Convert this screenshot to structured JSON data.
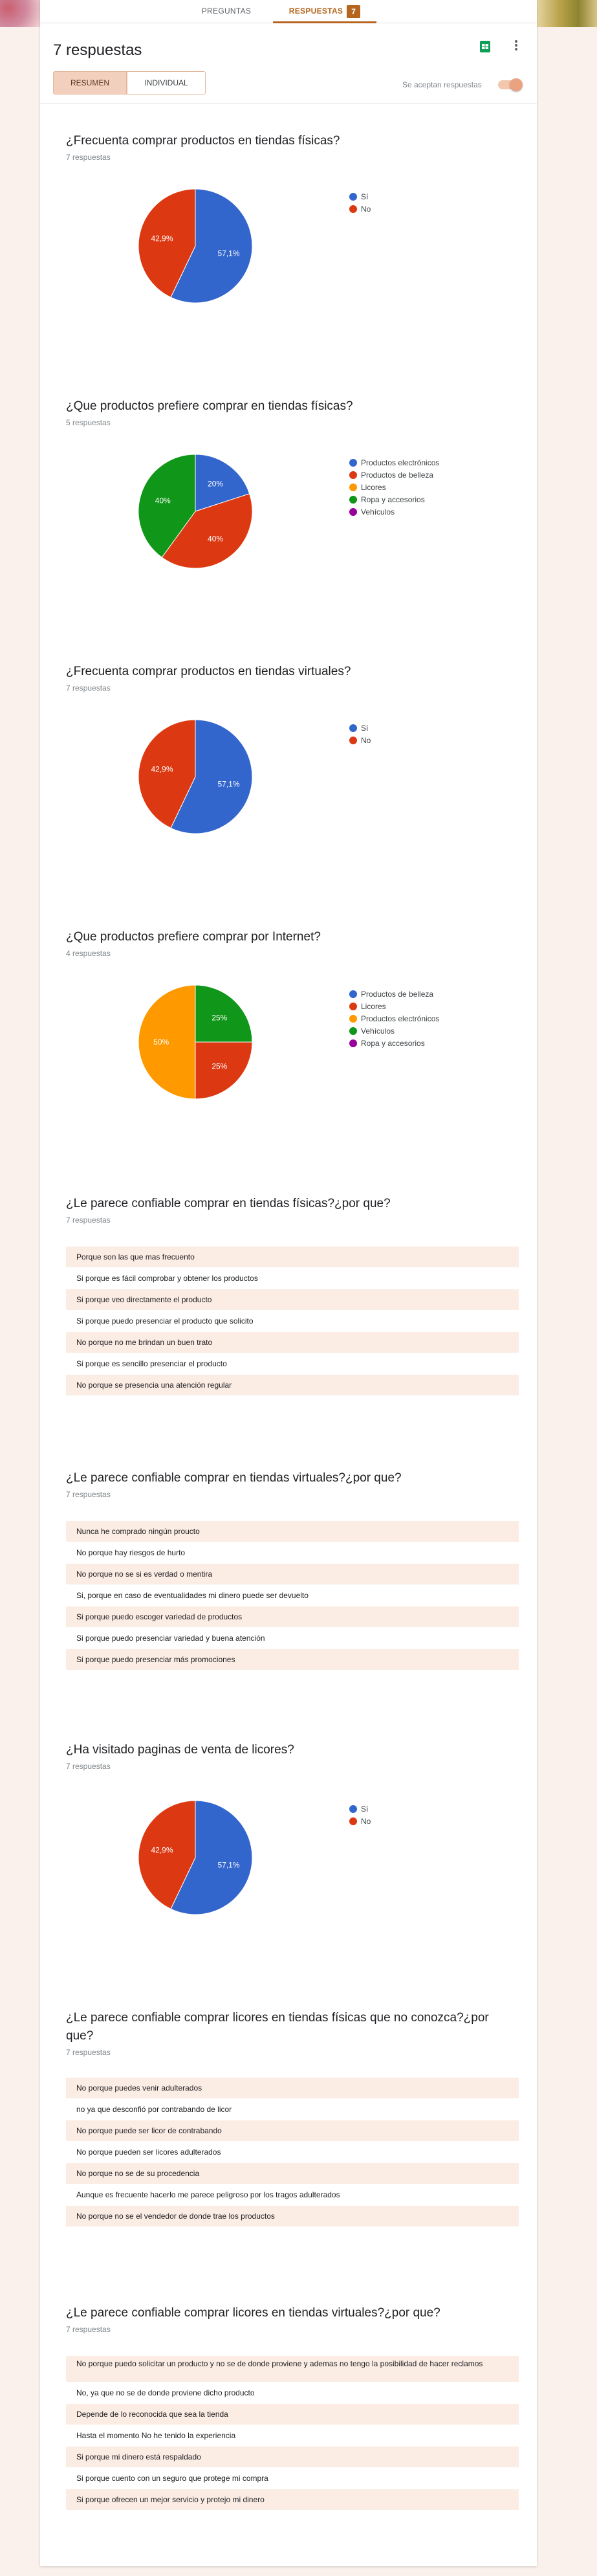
{
  "tabs": {
    "preguntas": "PREGUNTAS",
    "respuestas": "RESPUESTAS",
    "respuestas_count": "7"
  },
  "header": {
    "title": "7 respuestas"
  },
  "view": {
    "resumen": "RESUMEN",
    "individual": "INDIVIDUAL"
  },
  "accepting": {
    "label": "Se aceptan respuestas",
    "on": true
  },
  "colors": {
    "accent": "#b5651d",
    "blue": "#3366cc",
    "red": "#dc3912",
    "orange": "#ff9900",
    "green": "#109618",
    "purple": "#990099"
  },
  "questions": [
    {
      "title": "¿Frecuenta comprar productos en tiendas físicas?",
      "count": "7 respuestas",
      "legend": [
        {
          "label": "Sí",
          "color": "#3366cc"
        },
        {
          "label": "No",
          "color": "#dc3912"
        }
      ],
      "chart_data": {
        "type": "pie",
        "slices": [
          {
            "label": "Sí",
            "value": 57.1,
            "text": "57,1%",
            "color": "#3366cc"
          },
          {
            "label": "No",
            "value": 42.9,
            "text": "42,9%",
            "color": "#dc3912"
          }
        ]
      }
    },
    {
      "title": "¿Que productos prefiere comprar en tiendas físicas?",
      "count": "5 respuestas",
      "legend": [
        {
          "label": "Productos electrónicos",
          "color": "#3366cc"
        },
        {
          "label": "Productos de belleza",
          "color": "#dc3912"
        },
        {
          "label": "Licores",
          "color": "#ff9900"
        },
        {
          "label": "Ropa y accesorios",
          "color": "#109618"
        },
        {
          "label": "Vehículos",
          "color": "#990099"
        }
      ],
      "chart_data": {
        "type": "pie",
        "slices": [
          {
            "label": "Productos electrónicos",
            "value": 20,
            "text": "20%",
            "color": "#3366cc"
          },
          {
            "label": "Productos de belleza",
            "value": 40,
            "text": "40%",
            "color": "#dc3912"
          },
          {
            "label": "Ropa y accesorios",
            "value": 40,
            "text": "40%",
            "color": "#109618"
          }
        ]
      }
    },
    {
      "title": "¿Frecuenta comprar productos en tiendas virtuales?",
      "count": "7 respuestas",
      "legend": [
        {
          "label": "Sí",
          "color": "#3366cc"
        },
        {
          "label": "No",
          "color": "#dc3912"
        }
      ],
      "chart_data": {
        "type": "pie",
        "slices": [
          {
            "label": "Sí",
            "value": 57.1,
            "text": "57,1%",
            "color": "#3366cc"
          },
          {
            "label": "No",
            "value": 42.9,
            "text": "42,9%",
            "color": "#dc3912"
          }
        ]
      }
    },
    {
      "title": "¿Que productos prefiere comprar por Internet?",
      "count": "4 respuestas",
      "legend": [
        {
          "label": "Productos de belleza",
          "color": "#3366cc"
        },
        {
          "label": "Licores",
          "color": "#dc3912"
        },
        {
          "label": "Productos electrónicos",
          "color": "#ff9900"
        },
        {
          "label": "Vehículos",
          "color": "#109618"
        },
        {
          "label": "Ropa y accesorios",
          "color": "#990099"
        }
      ],
      "chart_data": {
        "type": "pie",
        "slices": [
          {
            "label": "Vehículos",
            "value": 25,
            "text": "25%",
            "color": "#109618"
          },
          {
            "label": "Licores",
            "value": 25,
            "text": "25%",
            "color": "#dc3912"
          },
          {
            "label": "Productos electrónicos",
            "value": 50,
            "text": "50%",
            "color": "#ff9900"
          }
        ]
      }
    },
    {
      "title": "¿Le parece confiable comprar en tiendas físicas?¿por que?",
      "count": "7 respuestas",
      "answers": [
        "Porque son las que mas frecuento",
        "Si porque es fácil comprobar y obtener los productos",
        "Si porque veo directamente el producto",
        "Si porque puedo presenciar el producto que solicito",
        "No porque no me brindan un buen trato",
        "Si porque es sencillo presenciar el producto",
        "No porque se presencia una atención regular"
      ]
    },
    {
      "title": "¿Le parece confiable comprar en tiendas virtuales?¿por que?",
      "count": "7 respuestas",
      "answers": [
        "Nunca he comprado ningún proucto",
        "No porque hay riesgos de hurto",
        "No porque no se si es verdad o mentira",
        "Si, porque en caso de eventualidades mi dinero puede ser devuelto",
        "Si porque puedo escoger variedad de productos",
        "Si porque puedo presenciar variedad y buena atención",
        "Si porque puedo presenciar más promociones"
      ]
    },
    {
      "title": "¿Ha visitado paginas de venta de licores?",
      "count": "7 respuestas",
      "legend": [
        {
          "label": "Sí",
          "color": "#3366cc"
        },
        {
          "label": "No",
          "color": "#dc3912"
        }
      ],
      "chart_data": {
        "type": "pie",
        "slices": [
          {
            "label": "Sí",
            "value": 57.1,
            "text": "57,1%",
            "color": "#3366cc"
          },
          {
            "label": "No",
            "value": 42.9,
            "text": "42,9%",
            "color": "#dc3912"
          }
        ]
      }
    },
    {
      "title": "¿Le parece confiable comprar licores en tiendas físicas que no conozca?¿por que?",
      "count": "7 respuestas",
      "answers": [
        "No porque puedes venir adulterados",
        "no ya que desconfió por contrabando de licor",
        "No porque puede ser licor de contrabando",
        "No porque pueden ser licores adulterados",
        "No porque no se de su procedencia",
        "Aunque es frecuente hacerlo me parece peligroso por los tragos adulterados",
        "No porque no se el vendedor de donde trae los productos"
      ]
    },
    {
      "title": "¿Le parece confiable comprar licores en tiendas virtuales?¿por que?",
      "count": "7 respuestas",
      "answers": [
        "No porque puedo solicitar un producto y no se de donde proviene y ademas no tengo la posibilidad de hacer reclamos",
        "No, ya que no se de donde proviene dicho producto",
        "Depende de lo reconocida que sea la tienda",
        "Hasta el momento No he tenido la experiencia",
        "Si porque mi dinero está respaldado",
        "Si porque cuento con un seguro que protege mi compra",
        "Si porque ofrecen un mejor servicio y protejo mi dinero"
      ]
    }
  ]
}
